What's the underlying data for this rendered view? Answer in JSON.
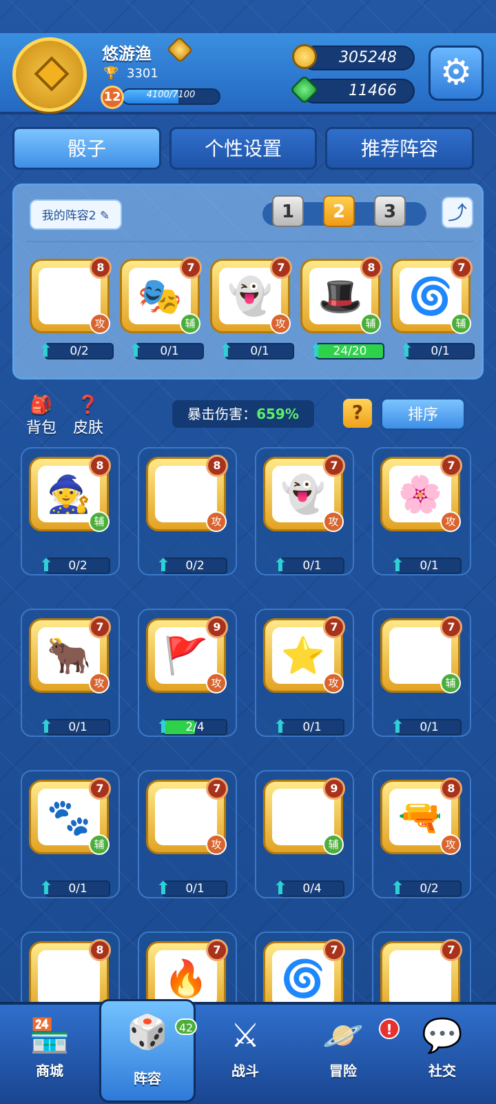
{
  "player": {
    "name": "悠游渔",
    "trophies": "3301",
    "level": "12",
    "xp_text": "4100/7100",
    "xp_fraction": 0.577
  },
  "currency": {
    "coins": "305248",
    "gems": "11466"
  },
  "tabs": [
    "骰子",
    "个性设置",
    "推荐阵容"
  ],
  "deck": {
    "name": "我的阵容2",
    "pages": [
      "1",
      "2",
      "3"
    ],
    "active_page": "2",
    "dice": [
      {
        "icon": "lightning-icon",
        "glyph": "⚡",
        "level": "8",
        "role": "攻",
        "progress": "0/2",
        "fill": 0
      },
      {
        "icon": "mask-icon",
        "glyph": "🎭",
        "level": "7",
        "role": "辅",
        "progress": "0/1",
        "fill": 0
      },
      {
        "icon": "ghost-icon",
        "glyph": "👻",
        "level": "7",
        "role": "攻",
        "progress": "0/1",
        "fill": 0
      },
      {
        "icon": "magic-hat-icon",
        "glyph": "🎩",
        "level": "8",
        "role": "辅",
        "progress": "24/20",
        "fill": 1
      },
      {
        "icon": "vortex-icon",
        "glyph": "🌀",
        "level": "7",
        "role": "辅",
        "progress": "0/1",
        "fill": 0
      }
    ]
  },
  "side": {
    "backpack": "背包",
    "skin": "皮肤"
  },
  "crit": {
    "label": "暴击伤害：",
    "value": "659%"
  },
  "sort_label": "排序",
  "collection": [
    {
      "icon": "witch-hat-icon",
      "glyph": "🧙",
      "level": "8",
      "role": "辅",
      "progress": "0/2",
      "fill": 0
    },
    {
      "icon": "lightning-icon",
      "glyph": "⚡",
      "level": "8",
      "role": "攻",
      "progress": "0/2",
      "fill": 0
    },
    {
      "icon": "ghost-icon",
      "glyph": "👻",
      "level": "7",
      "role": "攻",
      "progress": "0/1",
      "fill": 0
    },
    {
      "icon": "flower-icon",
      "glyph": "🌸",
      "level": "7",
      "role": "攻",
      "progress": "0/1",
      "fill": 0
    },
    {
      "icon": "bull-icon",
      "glyph": "🐂",
      "level": "7",
      "role": "攻",
      "progress": "0/1",
      "fill": 0
    },
    {
      "icon": "banner-icon",
      "glyph": "🚩",
      "level": "9",
      "role": "攻",
      "progress": "2/4",
      "fill": 0.5
    },
    {
      "icon": "shooting-star-icon",
      "glyph": "⭐",
      "level": "7",
      "role": "攻",
      "progress": "0/1",
      "fill": 0
    },
    {
      "icon": "lucky-cat-icon",
      "glyph": "🐱",
      "level": "7",
      "role": "辅",
      "progress": "0/1",
      "fill": 0
    },
    {
      "icon": "paw-icon",
      "glyph": "🐾",
      "level": "7",
      "role": "辅",
      "progress": "0/1",
      "fill": 0
    },
    {
      "icon": "grid-icon",
      "glyph": "▦",
      "level": "7",
      "role": "攻",
      "progress": "0/1",
      "fill": 0
    },
    {
      "icon": "eye-monster-icon",
      "glyph": "👁",
      "level": "9",
      "role": "辅",
      "progress": "0/4",
      "fill": 0
    },
    {
      "icon": "pistol-icon",
      "glyph": "🔫",
      "level": "8",
      "role": "攻",
      "progress": "0/2",
      "fill": 0
    },
    {
      "icon": "shuriken-icon",
      "glyph": "✴",
      "level": "8",
      "role": "",
      "progress": "",
      "fill": 0
    },
    {
      "icon": "flame-flag-icon",
      "glyph": "🔥",
      "level": "7",
      "role": "",
      "progress": "",
      "fill": 0
    },
    {
      "icon": "vortex-icon",
      "glyph": "🌀",
      "level": "7",
      "role": "",
      "progress": "",
      "fill": 0
    },
    {
      "icon": "snowflake-icon",
      "glyph": "❄",
      "level": "7",
      "role": "",
      "progress": "",
      "fill": 0
    }
  ],
  "nav": [
    {
      "label": "商城",
      "icon": "shop-icon",
      "glyph": "🏪"
    },
    {
      "label": "阵容",
      "icon": "dice-icon",
      "glyph": "🎲",
      "badge": "42"
    },
    {
      "label": "战斗",
      "icon": "swords-icon",
      "glyph": "⚔"
    },
    {
      "label": "冒险",
      "icon": "planet-icon",
      "glyph": "🪐",
      "notice": "!"
    },
    {
      "label": "社交",
      "icon": "chat-icon",
      "glyph": "💬"
    }
  ]
}
